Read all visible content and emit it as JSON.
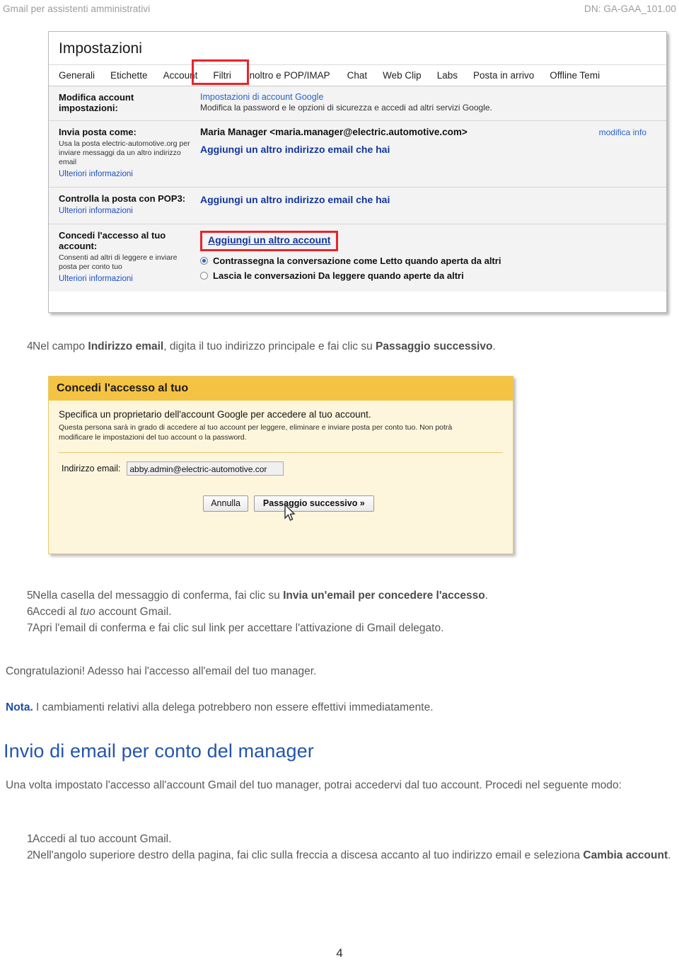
{
  "header": {
    "left": "Gmail per assistenti amministrativi",
    "right": "DN: GA-GAA_101.00"
  },
  "figure_settings": {
    "title": "Impostazioni",
    "tabs": [
      "Generali",
      "Etichette",
      "Account",
      "Filtri",
      "Inoltro e POP/IMAP",
      "Chat",
      "Web Clip",
      "Labs",
      "Posta in arrivo",
      "Offline Temi"
    ],
    "highlighted_tab": "Account",
    "rows": [
      {
        "label": "Modifica account",
        "label2": "impostazioni:",
        "link": "Impostazioni di account Google",
        "sub": "Modifica la password e le opzioni di sicurezza e accedi ad altri servizi Google."
      },
      {
        "label": "Invia posta come:",
        "desc": "Usa la posta electric-automotive.org per inviare messaggi da un altro indirizzo email",
        "more": "Ulteriori informazioni",
        "account": "Maria Manager <maria.manager@electric.automotive.com>",
        "edit_link": "modifica info",
        "add_link": "Aggiungi un altro indirizzo email che hai"
      },
      {
        "label": "Controlla la posta con POP3:",
        "more": "Ulteriori informazioni",
        "add_link": "Aggiungi un altro indirizzo email che hai"
      },
      {
        "label": "Concedi l'accesso al tuo",
        "label2": "account:",
        "desc": "Consenti ad altri di leggere e inviare posta per conto tuo",
        "more": "Ulteriori informazioni",
        "highlighted_button": "Aggiungi un altro account",
        "radio_selected": "Contrassegna la conversazione come Letto quando aperta da altri",
        "radio_unselected": "Lascia le conversazioni Da leggere quando aperte da altri"
      }
    ]
  },
  "step4": {
    "num": "4",
    "pre": "Nel campo ",
    "bold1": "Indirizzo email",
    "mid": ", digita il tuo indirizzo principale e fai clic su ",
    "bold2": "Passaggio successivo",
    "post": "."
  },
  "figure_dialog": {
    "heading": "Concedi l'accesso al tuo",
    "lead": "Specifica un proprietario dell'account Google per accedere al tuo account.",
    "sub": "Questa persona sarà in grado di accedere al tuo account per leggere, eliminare e inviare posta per conto tuo. Non potrà modificare le impostazioni del tuo account o la password.",
    "field_label": "Indirizzo email:",
    "field_value": "abby.admin@electric-automotive.cor",
    "cancel_button": "Annulla",
    "next_button": "Passaggio successivo »"
  },
  "steps_567": [
    {
      "num": "5",
      "pre": "Nella casella del messaggio di conferma, fai clic su ",
      "bold": "Invia un'email per concedere l'accesso",
      "post": "."
    },
    {
      "num": "6",
      "pre": "Accedi al ",
      "italic": "tuo",
      "post": " account Gmail."
    },
    {
      "num": "7",
      "pre": "Apri l'email di conferma e fai clic sul link per accettare l'attivazione di Gmail delegato.",
      "post": ""
    }
  ],
  "congrats": "Congratulazioni! Adesso hai l'accesso all'email del tuo manager.",
  "note": {
    "label": "Nota.",
    "text": " I cambiamenti relativi alla delega potrebbero non essere effettivi immediatamente."
  },
  "section": {
    "heading": "Invio di email per conto del manager",
    "intro": "Una volta impostato l'accesso all'account Gmail del tuo manager, potrai accedervi dal tuo account. Procedi nel seguente modo:"
  },
  "steps_12": [
    {
      "num": "1",
      "pre": "Accedi al tuo account Gmail.",
      "post": ""
    },
    {
      "num": "2",
      "pre": "Nell'angolo superiore destro della pagina, fai clic sulla freccia a discesa accanto al tuo indirizzo email e seleziona ",
      "bold": "Cambia account",
      "post": "."
    }
  ],
  "page_number": "4",
  "colors": {
    "body_text": "#58595b",
    "heading_blue": "#2355ad",
    "link_blue": "#2a62cb",
    "highlight_red": "#e8242a",
    "dialog_header": "#f5c344",
    "dialog_body": "#fdf6dd"
  }
}
